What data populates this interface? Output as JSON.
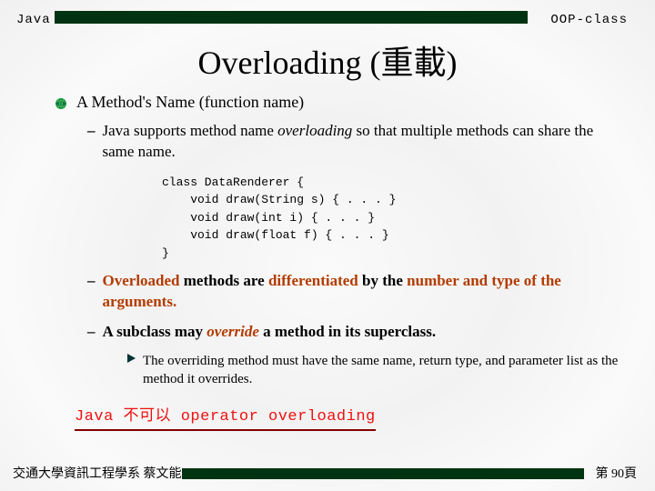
{
  "header": {
    "left": "Java",
    "right": "OOP-class"
  },
  "title": "Overloading (重載)",
  "b1": "A Method's Name (function name)",
  "b2a": {
    "pre": "Java supports method name ",
    "em": "overloading",
    "post": " so that multiple methods can share the same name."
  },
  "code": "class DataRenderer {\n    void draw(String s) { . . . }\n    void draw(int i) { . . . }\n    void draw(float f) { . . . }\n}",
  "b2b": {
    "s1": "Overloaded",
    "s2": " methods are ",
    "s3": "differentiated",
    "s4": " by the ",
    "s5": "number and type of the arguments",
    "s6": "."
  },
  "b2c": {
    "s1": "A subclass may ",
    "s2": "override",
    "s3": " a method in its superclass."
  },
  "b3a": "The overriding method must have the same name, return type, and parameter list as the method it overrides.",
  "callout": "Java 不可以 operator overloading",
  "footer": {
    "left": "交通大學資訊工程學系 蔡文能",
    "right": "第 90頁"
  }
}
